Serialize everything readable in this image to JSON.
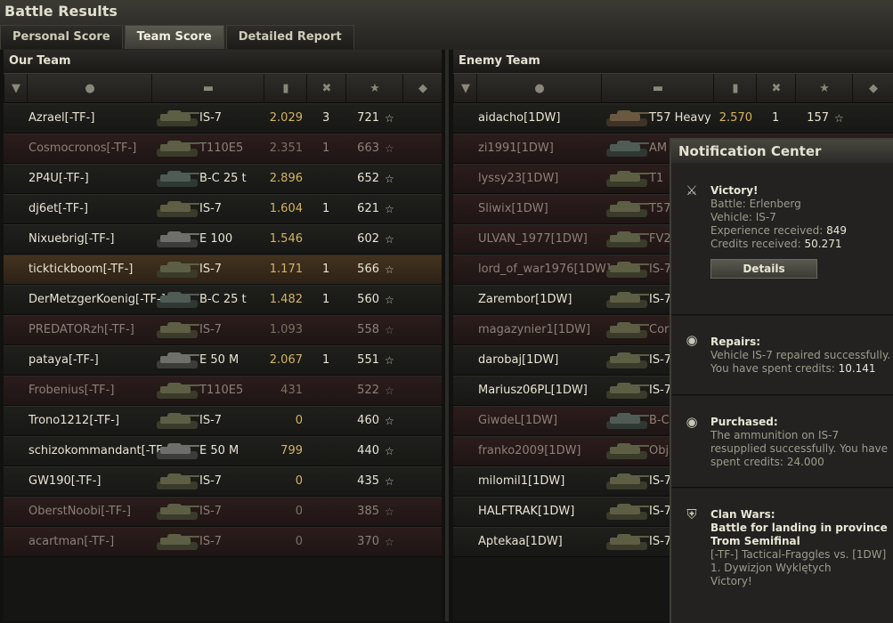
{
  "window": {
    "title": "Battle Results"
  },
  "tabs": [
    {
      "label": "Personal Score",
      "active": false
    },
    {
      "label": "Team Score",
      "active": true
    },
    {
      "label": "Detailed Report",
      "active": false
    }
  ],
  "our_team": {
    "title": "Our Team",
    "rows": [
      {
        "player": "Azrael[-TF-]",
        "tank": "IS-7",
        "tank_color": "heavy",
        "rating": "2.029",
        "kills": "3",
        "xp": "721",
        "state": "alive"
      },
      {
        "player": "Cosmocronos[-TF-]",
        "tank": "T110E5",
        "tank_color": "heavy",
        "rating": "2.351",
        "kills": "1",
        "xp": "663",
        "state": "dead"
      },
      {
        "player": "2P4U[-TF-]",
        "tank": "B-C 25 t",
        "tank_color": "medium",
        "rating": "2.896",
        "kills": "",
        "xp": "652",
        "state": "alive"
      },
      {
        "player": "dj6et[-TF-]",
        "tank": "IS-7",
        "tank_color": "heavy",
        "rating": "1.604",
        "kills": "1",
        "xp": "621",
        "state": "alive"
      },
      {
        "player": "Nixuebrig[-TF-]",
        "tank": "E 100",
        "tank_color": "grey",
        "rating": "1.546",
        "kills": "",
        "xp": "602",
        "state": "alive"
      },
      {
        "player": "ticktickboom[-TF-]",
        "tank": "IS-7",
        "tank_color": "heavy",
        "rating": "1.171",
        "kills": "1",
        "xp": "566",
        "state": "me"
      },
      {
        "player": "DerMetzgerKoenig[-TF-]",
        "tank": "B-C 25 t",
        "tank_color": "medium",
        "rating": "1.482",
        "kills": "1",
        "xp": "560",
        "state": "alive"
      },
      {
        "player": "PREDATORzh[-TF-]",
        "tank": "IS-7",
        "tank_color": "heavy",
        "rating": "1.093",
        "kills": "",
        "xp": "558",
        "state": "dead"
      },
      {
        "player": "pataya[-TF-]",
        "tank": "E 50 M",
        "tank_color": "grey",
        "rating": "2.067",
        "kills": "1",
        "xp": "551",
        "state": "alive"
      },
      {
        "player": "Frobenius[-TF-]",
        "tank": "T110E5",
        "tank_color": "heavy",
        "rating": "431",
        "kills": "",
        "xp": "522",
        "state": "dead"
      },
      {
        "player": "Trono1212[-TF-]",
        "tank": "IS-7",
        "tank_color": "heavy",
        "rating": "0",
        "kills": "",
        "xp": "460",
        "state": "alive"
      },
      {
        "player": "schizokommandant[-TF-]",
        "tank": "E 50 M",
        "tank_color": "grey",
        "rating": "799",
        "kills": "",
        "xp": "440",
        "state": "alive"
      },
      {
        "player": "GW190[-TF-]",
        "tank": "IS-7",
        "tank_color": "heavy",
        "rating": "0",
        "kills": "",
        "xp": "435",
        "state": "alive"
      },
      {
        "player": "OberstNoobi[-TF-]",
        "tank": "IS-7",
        "tank_color": "heavy",
        "rating": "0",
        "kills": "",
        "xp": "385",
        "state": "dead"
      },
      {
        "player": "acartman[-TF-]",
        "tank": "IS-7",
        "tank_color": "heavy",
        "rating": "0",
        "kills": "",
        "xp": "370",
        "state": "dead"
      }
    ]
  },
  "enemy_team": {
    "title": "Enemy Team",
    "rows": [
      {
        "player": "aidacho[1DW]",
        "tank": "T57 Heavy",
        "tank_color": "brown",
        "rating": "2.570",
        "kills": "1",
        "xp": "157",
        "state": "alive"
      },
      {
        "player": "zi1991[1DW]",
        "tank": "AM",
        "tank_color": "medium",
        "rating": "",
        "kills": "",
        "xp": "",
        "state": "dead"
      },
      {
        "player": "lyssy23[1DW]",
        "tank": "T1",
        "tank_color": "heavy",
        "rating": "",
        "kills": "",
        "xp": "",
        "state": "dead"
      },
      {
        "player": "Sliwix[1DW]",
        "tank": "T57",
        "tank_color": "heavy",
        "rating": "",
        "kills": "",
        "xp": "",
        "state": "dead"
      },
      {
        "player": "ULVAN_1977[1DW]",
        "tank": "FV2",
        "tank_color": "heavy",
        "rating": "",
        "kills": "",
        "xp": "",
        "state": "dead"
      },
      {
        "player": "lord_of_war1976[1DW]",
        "tank": "IS-7",
        "tank_color": "heavy",
        "rating": "",
        "kills": "",
        "xp": "",
        "state": "dead"
      },
      {
        "player": "Zarembor[1DW]",
        "tank": "IS-7",
        "tank_color": "heavy",
        "rating": "",
        "kills": "",
        "xp": "",
        "state": "alive"
      },
      {
        "player": "magazynier1[1DW]",
        "tank": "Cor",
        "tank_color": "heavy",
        "rating": "",
        "kills": "",
        "xp": "",
        "state": "dead"
      },
      {
        "player": "darobaj[1DW]",
        "tank": "IS-7",
        "tank_color": "heavy",
        "rating": "",
        "kills": "",
        "xp": "",
        "state": "alive"
      },
      {
        "player": "Mariusz06PL[1DW]",
        "tank": "IS-7",
        "tank_color": "heavy",
        "rating": "",
        "kills": "",
        "xp": "",
        "state": "alive"
      },
      {
        "player": "GiwdeL[1DW]",
        "tank": "B-C",
        "tank_color": "medium",
        "rating": "",
        "kills": "",
        "xp": "",
        "state": "dead"
      },
      {
        "player": "franko2009[1DW]",
        "tank": "Obj.",
        "tank_color": "heavy",
        "rating": "",
        "kills": "",
        "xp": "",
        "state": "dead"
      },
      {
        "player": "milomil1[1DW]",
        "tank": "IS-7",
        "tank_color": "heavy",
        "rating": "",
        "kills": "",
        "xp": "",
        "state": "alive"
      },
      {
        "player": "HALFTRAK[1DW]",
        "tank": "IS-7",
        "tank_color": "heavy",
        "rating": "",
        "kills": "",
        "xp": "",
        "state": "alive"
      },
      {
        "player": "Aptekaa[1DW]",
        "tank": "IS-7",
        "tank_color": "heavy",
        "rating": "",
        "kills": "",
        "xp": "",
        "state": "alive"
      }
    ]
  },
  "notification_center": {
    "title": "Notification Center",
    "victory": {
      "icon": "crossed-swords-icon",
      "heading": "Victory!",
      "battle": "Battle: Erlenberg",
      "vehicle": "Vehicle: IS-7",
      "experience_label": "Experience received:",
      "experience_value": "849",
      "credits_label": "Credits received:",
      "credits_value": "50.271",
      "details_button": "Details"
    },
    "repairs": {
      "icon": "coins-icon",
      "heading": "Repairs:",
      "text": "Vehicle IS-7 repaired successfully. You have spent credits:",
      "value": "10.141"
    },
    "purchased": {
      "icon": "coins-icon",
      "heading": "Purchased:",
      "text": "The ammunition on IS-7 resupplied successfully. You have spent credits:",
      "value": "24.000"
    },
    "clan_wars": {
      "icon": "shield-icon",
      "heading": "Clan Wars:",
      "subheading": "Battle for landing in province Trom Semifinal",
      "text": "[-TF-] Tactical-Fraggles vs. [1DW] 1. Dywizjon Wyklętych",
      "result": "Victory!"
    }
  },
  "colors": {
    "rating": "#d4b460",
    "dead_row": "#2b1d1b",
    "self_row": "#43321f",
    "panel": "#151513"
  }
}
